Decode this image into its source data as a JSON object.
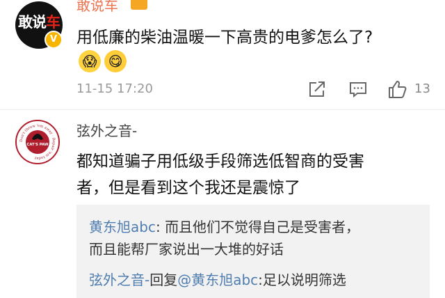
{
  "comment1": {
    "username": "敢说车",
    "avatar_text_white": "敢说",
    "avatar_text_red": "车",
    "verified_badge": "V",
    "text": "用低廉的柴油温暖一下高贵的电爹怎么了?",
    "emojis": [
      "surprised-face-icon",
      "yum-face-icon"
    ],
    "time": "11-15 17:20",
    "actions": {
      "share_icon": "share-icon",
      "comment_icon": "comment-icon",
      "like_icon": "thumbs-up-icon",
      "like_count": "13"
    }
  },
  "comment2": {
    "username": "弦外之音-",
    "avatar_ring_text": "Don't throw 'em away · Repair 'em today",
    "avatar_center_text": "CAT'S PAW",
    "text_line1": "都知道骗子用低级手段筛选低智商的受害",
    "text_line2": "者，但是看到这个我还是震惊了",
    "replies": [
      {
        "author": "黄东旭abc",
        "sep": ": ",
        "text_line1": "而且他们不觉得自己是受害者，",
        "text_line2": "而且能帮厂家说出一大堆的好话"
      },
      {
        "author": "弦外之音-",
        "reply_word": "回复",
        "mention": "@黄东旭abc",
        "text": ":足以说明筛选"
      }
    ]
  },
  "colors": {
    "link": "#507daf",
    "username_highlight": "#eb7350",
    "muted": "#999999",
    "reply_bg": "#f2f2f2"
  }
}
